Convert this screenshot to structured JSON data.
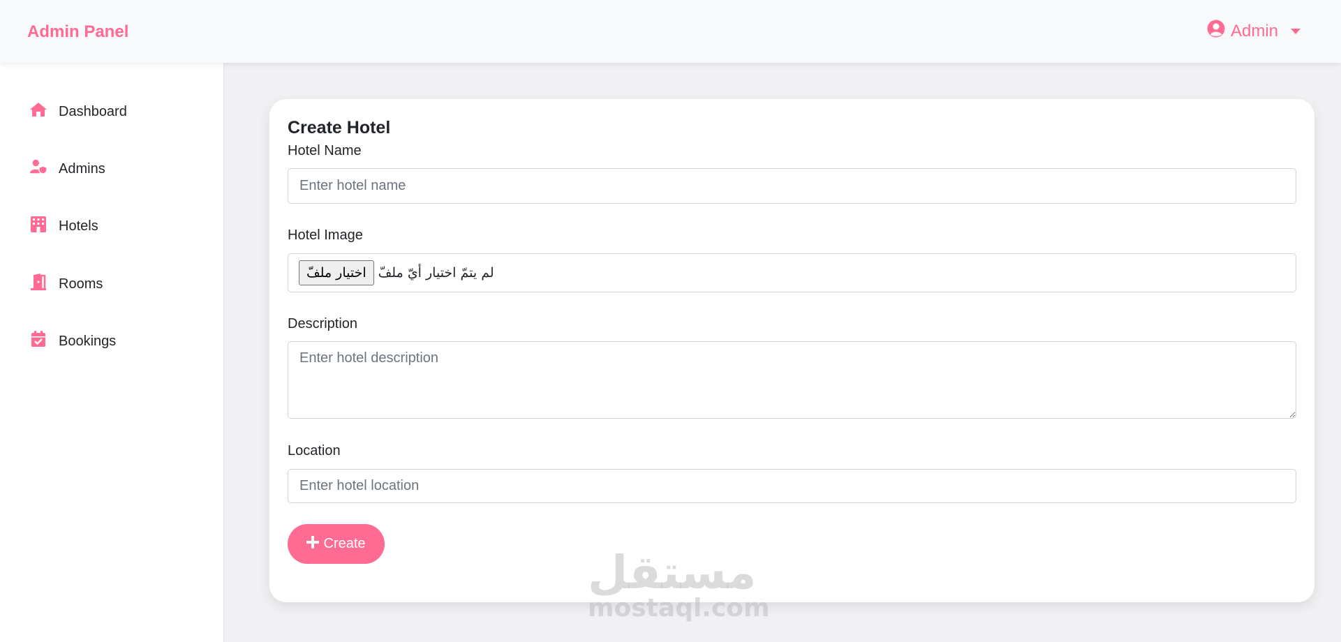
{
  "navbar": {
    "brand": "Admin Panel",
    "user_label": "Admin",
    "user_icon": "user-circle-icon",
    "dropdown_icon": "caret-down-icon"
  },
  "sidebar": {
    "items": [
      {
        "label": "Dashboard",
        "icon": "home-icon"
      },
      {
        "label": "Admins",
        "icon": "user-shield-icon"
      },
      {
        "label": "Hotels",
        "icon": "hotel-icon"
      },
      {
        "label": "Rooms",
        "icon": "door-icon"
      },
      {
        "label": "Bookings",
        "icon": "calendar-check-icon"
      }
    ]
  },
  "form": {
    "title": "Create Hotel",
    "hotel_name_label": "Hotel Name",
    "hotel_name_placeholder": "Enter hotel name",
    "hotel_image_label": "Hotel Image",
    "file_button_label": "اختيار ملفّ",
    "file_status": "لم يتمّ اختيار أيّ ملفّ",
    "description_label": "Description",
    "description_placeholder": "Enter hotel description",
    "location_label": "Location",
    "location_placeholder": "Enter hotel location",
    "create_button_label": "Create"
  },
  "watermark": {
    "arabic": "مستقل",
    "latin": "mostaql.com"
  },
  "colors": {
    "accent": "#ff6b93",
    "navbar_bg": "#f8f9fa",
    "page_bg": "#f1f1f3"
  }
}
